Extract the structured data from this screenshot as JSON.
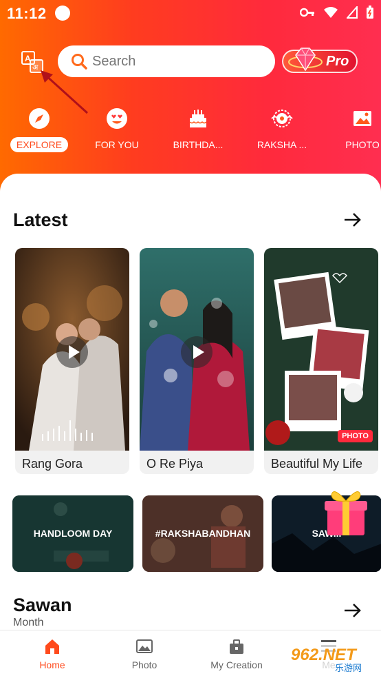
{
  "status_bar": {
    "time": "11:12"
  },
  "top": {
    "search_placeholder": "Search",
    "pro_label": "Pro"
  },
  "categories": [
    {
      "label": "EXPLORE",
      "icon": "compass-icon",
      "active": true
    },
    {
      "label": "FOR YOU",
      "icon": "heart-eyes-icon",
      "active": false
    },
    {
      "label": "BIRTHDA...",
      "icon": "cake-icon",
      "active": false
    },
    {
      "label": "RAKSHA ...",
      "icon": "rakhi-icon",
      "active": false
    },
    {
      "label": "PHOTO",
      "icon": "photo-icon",
      "active": false
    }
  ],
  "latest": {
    "title": "Latest",
    "cards": [
      {
        "title": "Rang Gora",
        "type": "video"
      },
      {
        "title": "O Re Piya",
        "type": "video"
      },
      {
        "title": "Beautiful My Life",
        "type": "photo",
        "badge": "PHOTO"
      }
    ]
  },
  "tiles": [
    {
      "label": "HANDLOOM DAY"
    },
    {
      "label": "#RAKSHABANDHAN"
    },
    {
      "label": "SAW..."
    }
  ],
  "sawan": {
    "title": "Sawan",
    "subtitle": "Month"
  },
  "bottom_nav": [
    {
      "label": "Home",
      "icon": "home-icon",
      "active": true
    },
    {
      "label": "Photo",
      "icon": "photo-icon",
      "active": false
    },
    {
      "label": "My Creation",
      "icon": "briefcase-icon",
      "active": false
    },
    {
      "label": "Me",
      "icon": "menu-icon",
      "active": false
    }
  ],
  "watermark": {
    "text": "962.NET",
    "subtext": "乐游网"
  },
  "colors": {
    "accent": "#ff4a1c",
    "header_start": "#ff6a00",
    "header_end": "#ff2e50"
  }
}
